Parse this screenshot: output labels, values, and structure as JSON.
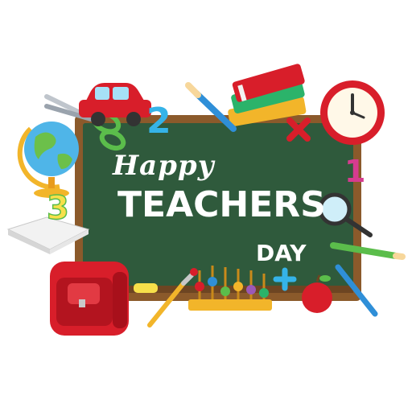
{
  "greeting": {
    "line1": "Happy",
    "line2": "TEACHERS",
    "line3": "DAY"
  },
  "digits": {
    "two": "2",
    "three": "3",
    "one": "1"
  },
  "colors": {
    "board_green": "#2f5a3c",
    "board_frame": "#8b5a2b",
    "text": "#ffffff",
    "accent_red": "#d81e2a",
    "accent_blue": "#2f8fd8",
    "accent_yellow": "#f6c21b"
  }
}
